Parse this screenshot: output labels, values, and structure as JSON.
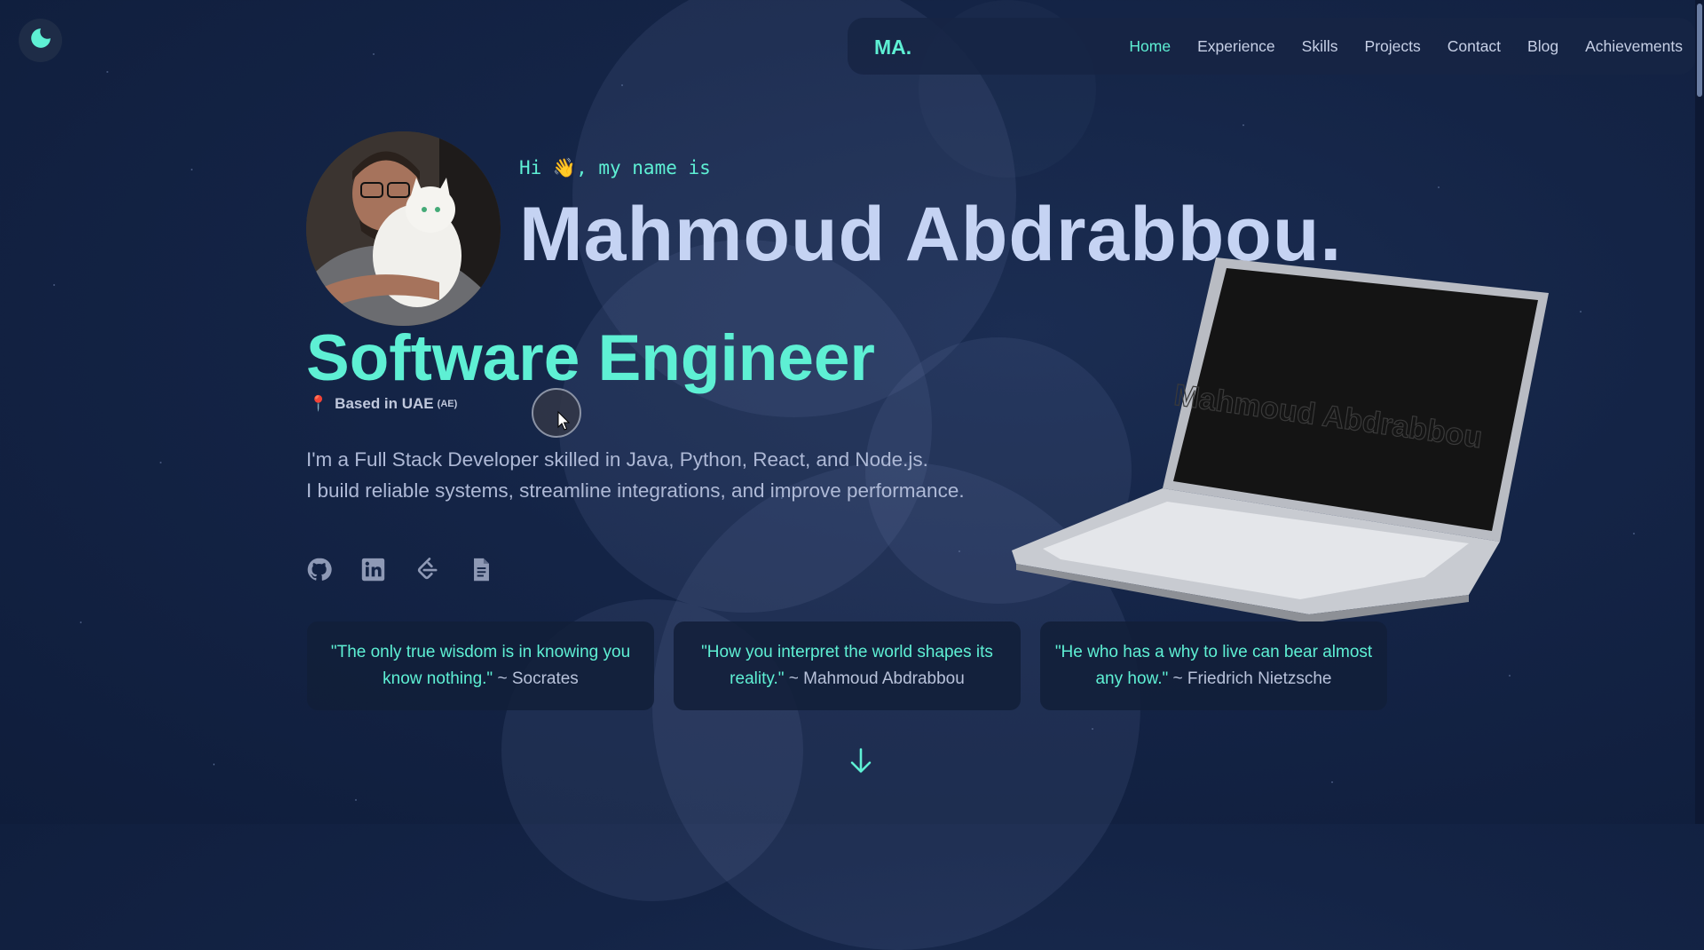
{
  "navbar": {
    "logo": "MA.",
    "links": [
      "Home",
      "Experience",
      "Skills",
      "Projects",
      "Contact",
      "Blog",
      "Achievements"
    ],
    "active": "Home"
  },
  "hero": {
    "greeting": "Hi 👋, my name is",
    "name": "Mahmoud Abdrabbou.",
    "role": "Software Engineer",
    "location_pin": "📍",
    "location": "Based in UAE",
    "location_code": "(AE)",
    "bio_line1": "I'm a Full Stack Developer skilled in Java, Python, React, and Node.js.",
    "bio_line2": "I build reliable systems, streamline integrations, and improve performance."
  },
  "laptop_screen_text": "Mahmoud Abdrabbou",
  "socials": [
    {
      "icon": "github-icon"
    },
    {
      "icon": "linkedin-icon"
    },
    {
      "icon": "leetcode-icon"
    },
    {
      "icon": "resume-icon"
    }
  ],
  "quotes": [
    {
      "text": "\"The only true wisdom is in knowing you know nothing.\"",
      "author": "~ Socrates"
    },
    {
      "text": "\"How you interpret the world shapes its reality.\"",
      "author": "~ Mahmoud Abdrabbou"
    },
    {
      "text": "\"He who has a why to live can bear almost any how.\"",
      "author": "~ Friedrich Nietzsche"
    }
  ],
  "colors": {
    "accent": "#5ef0d4",
    "background": "#142446",
    "name": "#c5d3f3"
  }
}
